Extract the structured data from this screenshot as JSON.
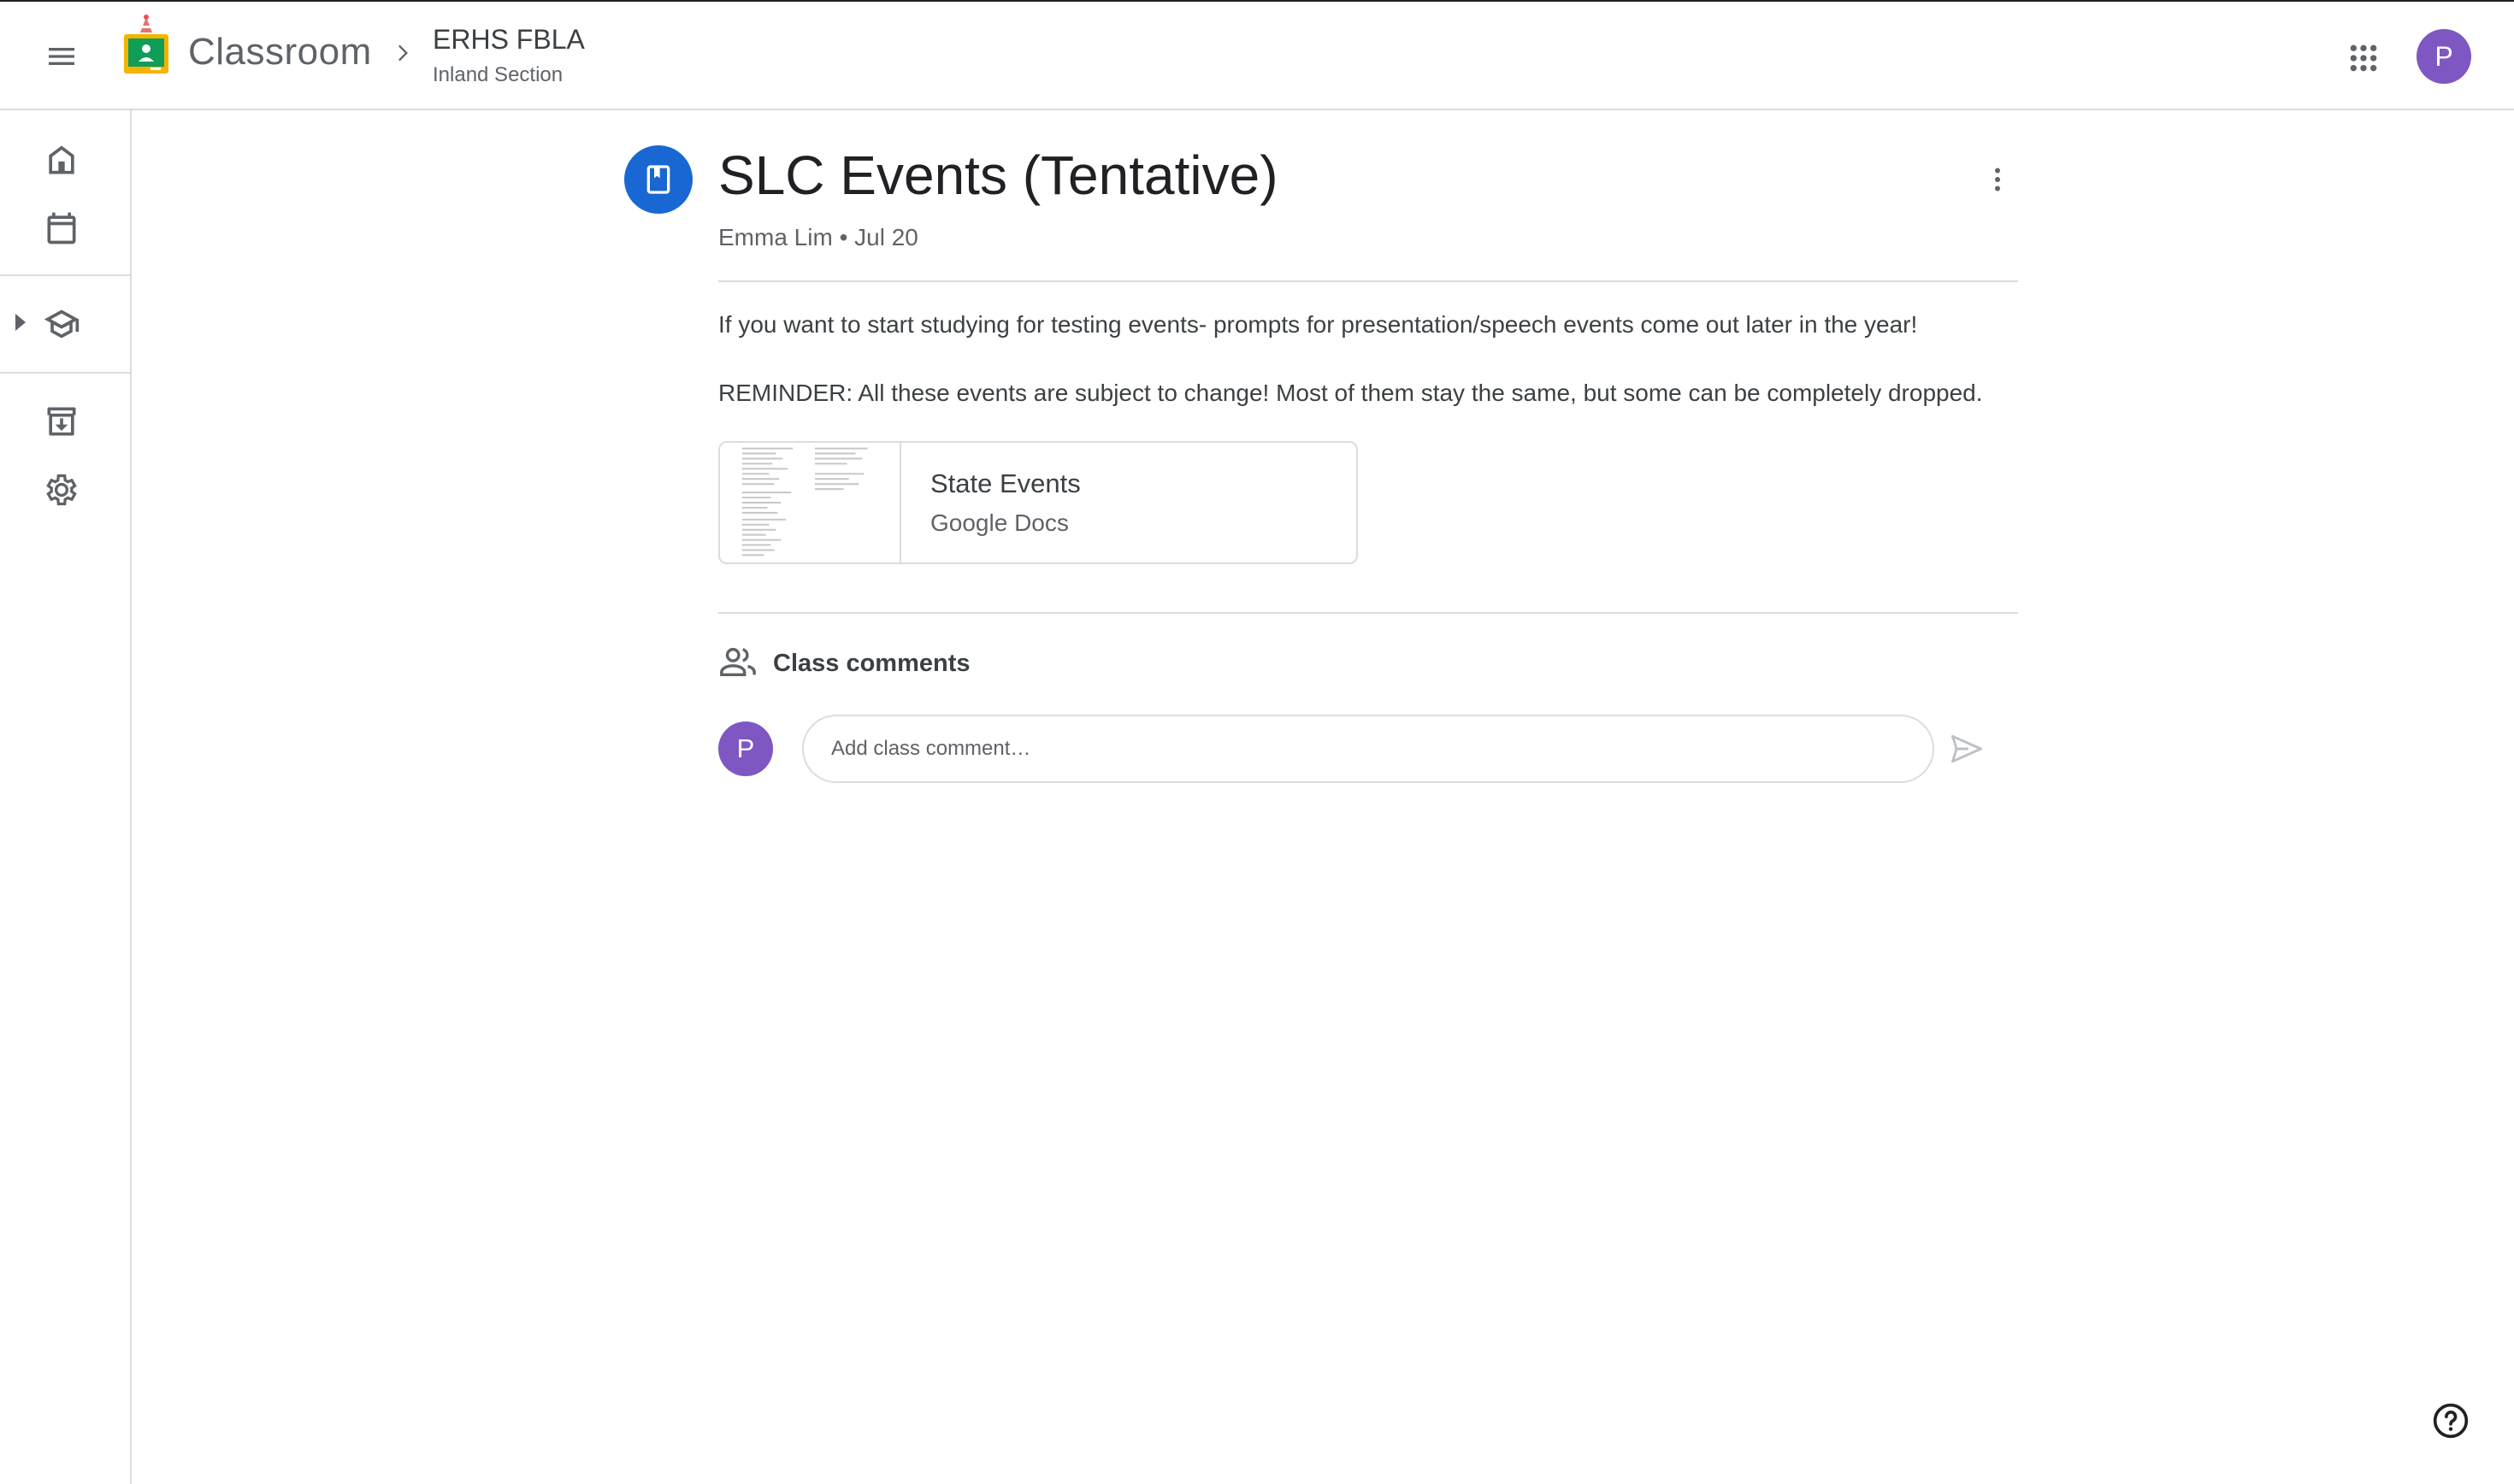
{
  "app": {
    "brand": "Classroom",
    "logo_icon": "google-classroom-logo",
    "accent": "#1967d2",
    "avatar_color": "#7e57c2"
  },
  "header": {
    "menu_icon": "hamburger-menu-icon",
    "class_name": "ERHS FBLA",
    "class_section": "Inland Section",
    "apps_icon": "apps-grid-icon",
    "user_initial": "P"
  },
  "sidebar": {
    "items": [
      {
        "name": "home",
        "icon": "home-icon"
      },
      {
        "name": "calendar",
        "icon": "calendar-icon"
      },
      {
        "name": "enrolled",
        "icon": "graduation-cap-icon"
      },
      {
        "name": "archived",
        "icon": "archive-icon"
      },
      {
        "name": "settings",
        "icon": "gear-icon"
      }
    ]
  },
  "post": {
    "icon": "material-bookmark-icon",
    "title": "SLC Events (Tentative)",
    "meta": "Emma Lim • Jul 20",
    "body": [
      "If you want to start studying for testing events- prompts for presentation/speech events come out later in the year!",
      "REMINDER: All these events are subject to change! Most of them stay the same, but some can be completely dropped."
    ],
    "attachment": {
      "title": "State Events",
      "type": "Google Docs"
    }
  },
  "comments": {
    "label": "Class comments",
    "user_initial": "P",
    "placeholder": "Add class comment…"
  },
  "help_icon": "help-circle-icon"
}
